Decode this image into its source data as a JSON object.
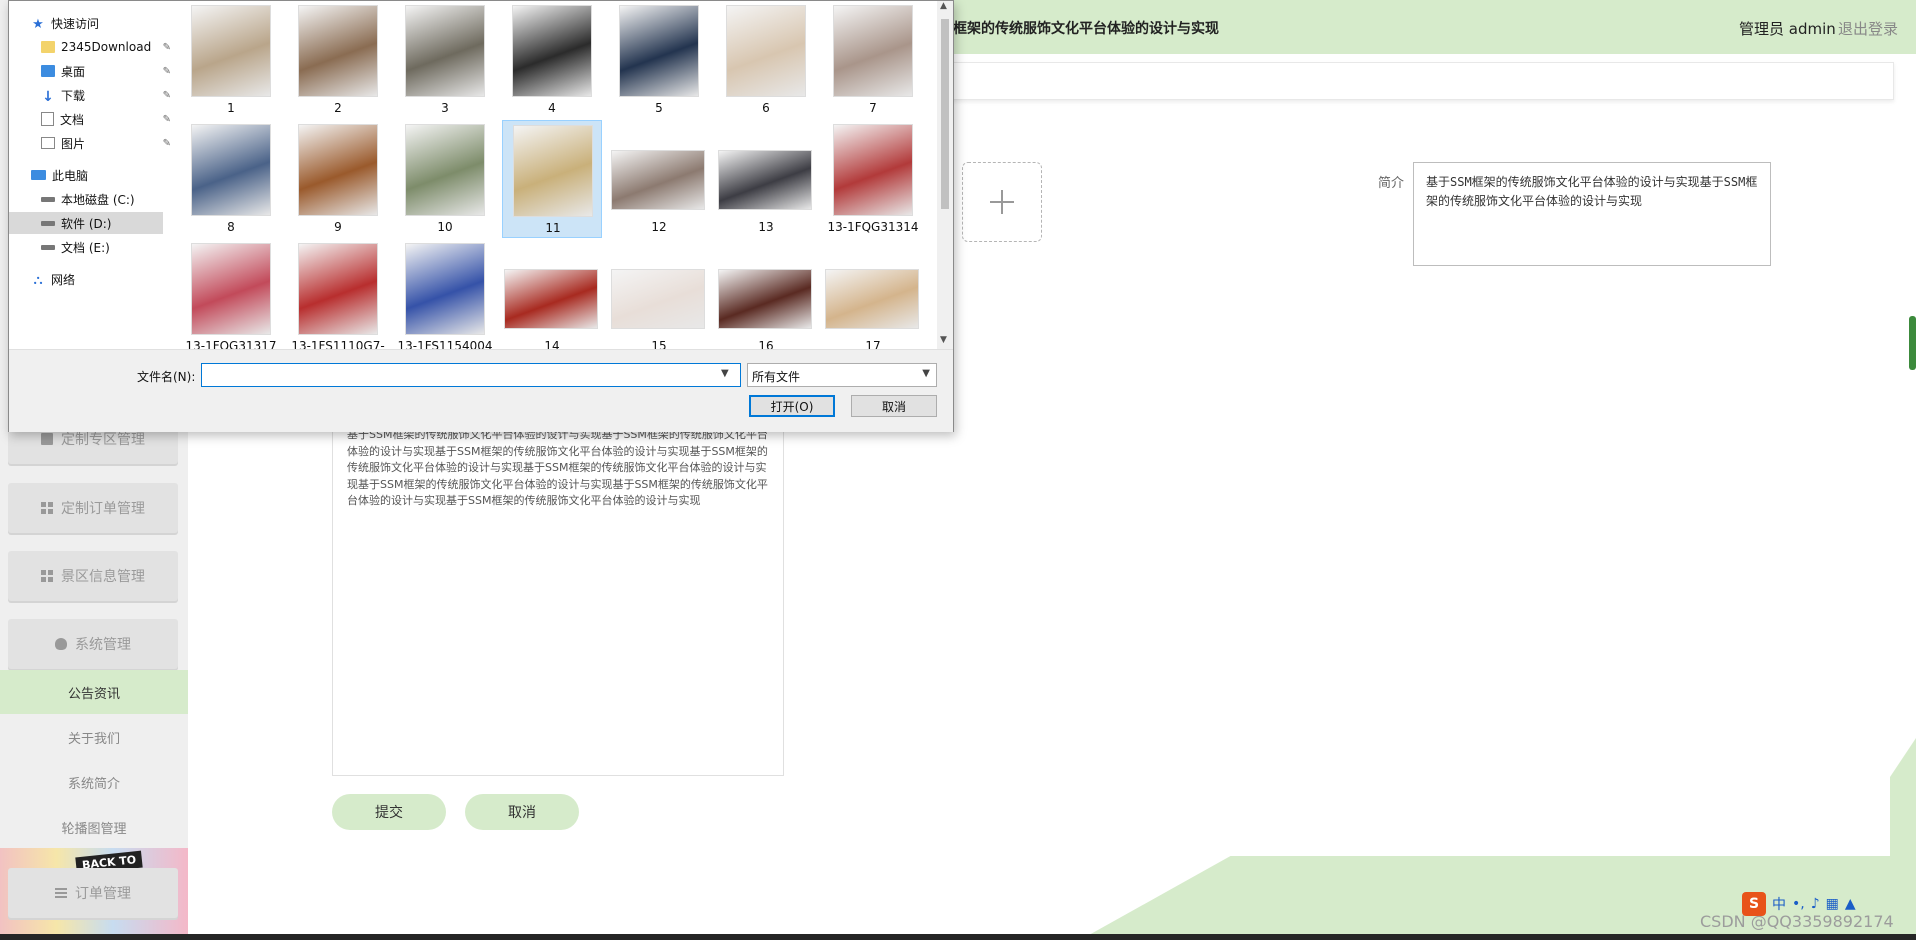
{
  "header": {
    "title": "框架的传统服饰文化平台体验的设计与实现",
    "user": "管理员 admin",
    "logout": "退出登录"
  },
  "sidebar": {
    "menus": [
      {
        "label": "定制专区管理",
        "icon": "monitor-icon"
      },
      {
        "label": "定制订单管理",
        "icon": "grid-icon"
      },
      {
        "label": "景区信息管理",
        "icon": "grid-icon"
      },
      {
        "label": "系统管理",
        "icon": "bulb-icon"
      }
    ],
    "sub_items": [
      {
        "label": "公告资讯",
        "active": true
      },
      {
        "label": "关于我们",
        "active": false
      },
      {
        "label": "系统简介",
        "active": false
      },
      {
        "label": "轮播图管理",
        "active": false
      }
    ],
    "order_menu": "订单管理",
    "banner_text": "BACK TO"
  },
  "form": {
    "intro_label": "简介",
    "intro_value": "基于SSM框架的传统服饰文化平台体验的设计与实现基于SSM框架的传统服饰文化平台体验的设计与实现",
    "editor_text": "基于SSM框架的传统服饰文化平台体验的设计与实现基于SSM框架的传统服饰文化平台体验的设计与实现基于SSM框架的传统服饰文化平台体验的设计与实现基于SSM框架的传统服饰文化平台体验的设计与实现基于SSM框架的传统服饰文化平台体验的设计与实现基于SSM框架的传统服饰文化平台体验的设计与实现基于SSM框架的传统服饰文化平台体验的设计与实现基于SSM框架的传统服饰文化平台体验的设计与实现",
    "submit": "提交",
    "cancel": "取消"
  },
  "dialog": {
    "nav": [
      {
        "label": "快速访问",
        "icon": "star-icon",
        "pinned": false
      },
      {
        "label": "2345Download",
        "icon": "folder-icon",
        "pinned": true
      },
      {
        "label": "桌面",
        "icon": "desktop-icon",
        "pinned": true
      },
      {
        "label": "下载",
        "icon": "download-icon",
        "pinned": true
      },
      {
        "label": "文档",
        "icon": "document-icon",
        "pinned": true
      },
      {
        "label": "图片",
        "icon": "picture-icon",
        "pinned": true
      },
      {
        "label": "此电脑",
        "icon": "pc-icon",
        "pinned": false
      },
      {
        "label": "本地磁盘 (C:)",
        "icon": "drive-icon",
        "pinned": false
      },
      {
        "label": "软件 (D:)",
        "icon": "drive-icon",
        "pinned": false,
        "selected": true
      },
      {
        "label": "文档 (E:)",
        "icon": "drive-icon",
        "pinned": false
      },
      {
        "label": "网络",
        "icon": "network-icon",
        "pinned": false
      }
    ],
    "files": [
      {
        "name": "1",
        "color": "#b9a58a"
      },
      {
        "name": "2",
        "color": "#8a6c52"
      },
      {
        "name": "3",
        "color": "#6e6a5e"
      },
      {
        "name": "4",
        "color": "#2b2b2b"
      },
      {
        "name": "5",
        "color": "#23344f"
      },
      {
        "name": "6",
        "color": "#d8c6b0"
      },
      {
        "name": "7",
        "color": "#a9958a"
      },
      {
        "name": "8",
        "color": "#4a6288"
      },
      {
        "name": "9",
        "color": "#9a5a2c"
      },
      {
        "name": "10",
        "color": "#7d8c6a"
      },
      {
        "name": "11",
        "color": "#c9b07a",
        "selected": true
      },
      {
        "name": "12",
        "color": "#8c7a70",
        "wide": true
      },
      {
        "name": "13",
        "color": "#3d3d44",
        "wide": true
      },
      {
        "name": "13-1FQG31314",
        "color": "#b23a3a"
      },
      {
        "name": "13-1FQG31317",
        "color": "#c24a5a"
      },
      {
        "name": "13-1FS1110G7-",
        "color": "#b82e2e"
      },
      {
        "name": "13-1FS1154004",
        "color": "#3552a8"
      },
      {
        "name": "14",
        "color": "#a82a20",
        "wide": true
      },
      {
        "name": "15",
        "color": "#e8ded8",
        "wide": true
      },
      {
        "name": "16",
        "color": "#5a2a22",
        "wide": true
      },
      {
        "name": "17",
        "color": "#d4b48c",
        "wide": true
      }
    ],
    "filename_label": "文件名(N):",
    "filename_value": "",
    "filetype": "所有文件",
    "open": "打开(O)",
    "cancel": "取消"
  },
  "watermark": "CSDN @QQ3359892174",
  "ime": {
    "logo": "S",
    "lang": "中"
  },
  "colors": {
    "accent": "#d6ebcb",
    "dialog_focus": "#0078d7"
  }
}
